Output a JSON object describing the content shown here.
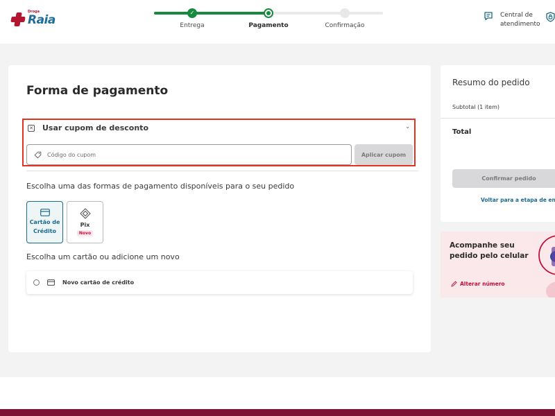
{
  "header": {
    "logo_small": "Droga",
    "logo_main": "Raia",
    "steps": [
      {
        "label": "Entrega",
        "state": "done"
      },
      {
        "label": "Pagamento",
        "state": "current"
      },
      {
        "label": "Confirmação",
        "state": "pending"
      }
    ],
    "help_label": "Central de atendimento"
  },
  "main": {
    "title": "Forma de pagamento",
    "coupon": {
      "title": "Usar cupom de desconto",
      "placeholder": "Código do cupom",
      "apply_label": "Aplicar cupom"
    },
    "payment_prompt": "Escolha uma das formas de pagamento disponíveis para o seu pedido",
    "payment_options": [
      {
        "label": "Cartão de Crédito",
        "icon": "credit-card-icon",
        "selected": true
      },
      {
        "label": "Pix",
        "icon": "pix-icon",
        "badge": "Novo",
        "selected": false
      }
    ],
    "card_prompt": "Escolha um cartão ou adicione um novo",
    "new_card_label": "Novo cartão de crédito"
  },
  "summary": {
    "title": "Resumo do pedido",
    "subtotal_label": "Subtotal (1 item)",
    "total_label": "Total",
    "confirm_label": "Confirmar pedido",
    "back_link": "Voltar para a etapa de entre"
  },
  "promo": {
    "title": "Acompanhe seu pedido pelo celular",
    "link_label": "Alterar número"
  },
  "colors": {
    "accent_green": "#178a3e",
    "brand_teal": "#1a6b8a",
    "highlight_red": "#e53220",
    "footer": "#7d1334"
  }
}
